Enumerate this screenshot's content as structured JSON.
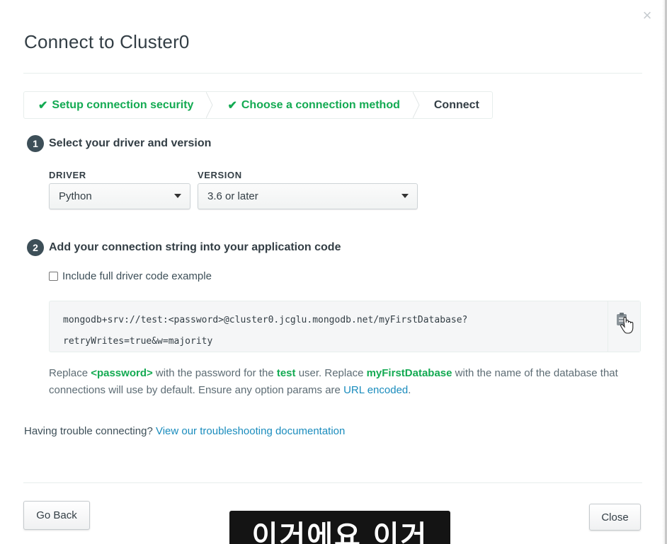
{
  "modal": {
    "title": "Connect to Cluster0",
    "close_glyph": "×"
  },
  "steps": [
    {
      "label": "Setup connection security",
      "state": "done"
    },
    {
      "label": "Choose a connection method",
      "state": "done"
    },
    {
      "label": "Connect",
      "state": "current"
    }
  ],
  "check_glyph": "✔",
  "section1": {
    "number": "1",
    "title": "Select your driver and version",
    "driver_label": "DRIVER",
    "driver_value": "Python",
    "version_label": "VERSION",
    "version_value": "3.6 or later"
  },
  "section2": {
    "number": "2",
    "title": "Add your connection string into your application code",
    "checkbox_label": "Include full driver code example",
    "checkbox_checked": false,
    "connection_string_line1": "mongodb+srv://test:<password>@cluster0.jcglu.mongodb.net/myFirstDatabase?",
    "connection_string_line2": "retryWrites=true&w=majority",
    "copy_icon": "clipboard-icon"
  },
  "help": {
    "t1": "Replace ",
    "password_token": "<password>",
    "t2": " with the password for the ",
    "user": "test",
    "t3": " user. Replace ",
    "db": "myFirstDatabase",
    "t4": " with the name of the database that connections will use by default. Ensure any option params are ",
    "url_encoded_link": "URL encoded",
    "t5": "."
  },
  "trouble": {
    "text": "Having trouble connecting? ",
    "link": "View our troubleshooting documentation"
  },
  "footer": {
    "go_back": "Go Back",
    "close": "Close"
  },
  "subtitle_overlay": "이거에요 이거",
  "colors": {
    "accent_green": "#13aa52",
    "link_blue": "#1a8cbd",
    "text_dark": "#333e45"
  }
}
